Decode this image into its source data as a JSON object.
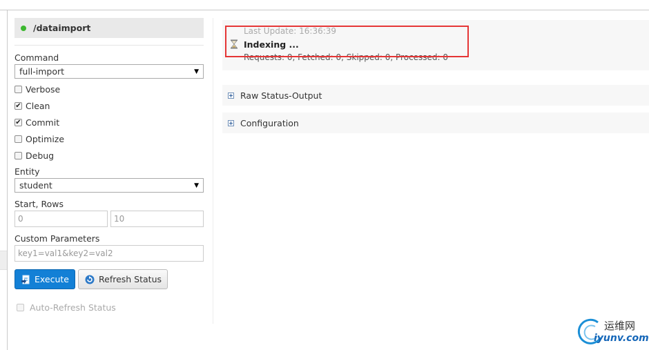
{
  "core": {
    "name": "/dataimport",
    "status_color": "#3cb72f"
  },
  "command": {
    "label": "Command",
    "value": "full-import"
  },
  "options": [
    {
      "label": "Verbose",
      "checked": false
    },
    {
      "label": "Clean",
      "checked": true
    },
    {
      "label": "Commit",
      "checked": true
    },
    {
      "label": "Optimize",
      "checked": false
    },
    {
      "label": "Debug",
      "checked": false
    }
  ],
  "entity": {
    "label": "Entity",
    "value": "student"
  },
  "start_rows": {
    "label": "Start, Rows",
    "start_placeholder": "0",
    "rows_placeholder": "10"
  },
  "custom_params": {
    "label": "Custom Parameters",
    "placeholder": "key1=val1&key2=val2"
  },
  "buttons": {
    "execute": "Execute",
    "refresh": "Refresh Status"
  },
  "auto_refresh": {
    "label": "Auto-Refresh Status",
    "checked": false
  },
  "status": {
    "last_update": "Last Update: 16:36:39",
    "state": "Indexing ...",
    "requests": "Requests: 0, Fetched: 0, Skipped: 0, Processed: 0"
  },
  "sections": [
    {
      "label": "Raw Status-Output"
    },
    {
      "label": "Configuration"
    }
  ],
  "watermark": {
    "cn": "运维网",
    "en": "iyunv.com"
  },
  "colors": {
    "execute_bg": "#1380d6",
    "highlight_border": "#e53535"
  }
}
